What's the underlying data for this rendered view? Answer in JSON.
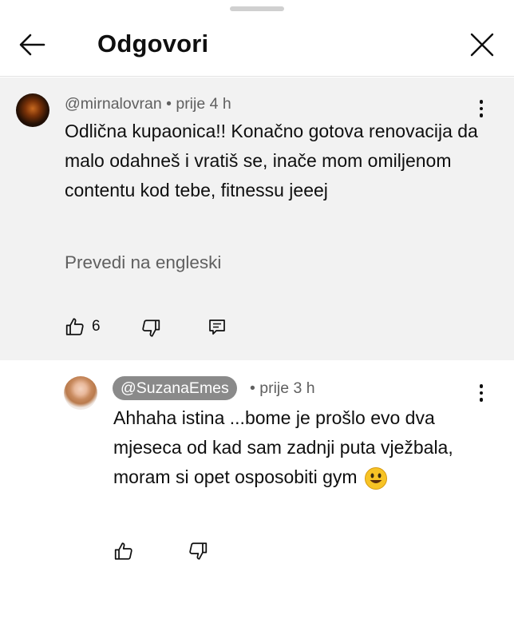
{
  "header": {
    "title": "Odgovori",
    "back_icon": "arrow-left-icon",
    "close_icon": "close-icon"
  },
  "parent_comment": {
    "handle": "@mirnalovran",
    "separator": "•",
    "time": "prije 4 h",
    "text": "Odlična kupaonica!! Konačno gotova renovacija da malo odahneš i vratiš se, inače mom omiljenom contentu kod tebe, fitnessu jeeej",
    "translate_label": "Prevedi na engleski",
    "like_count": "6",
    "icons": [
      "thumbs-up-icon",
      "thumbs-down-icon",
      "reply-icon",
      "more-vertical-icon"
    ]
  },
  "reply": {
    "handle": "@SuzanaEmes",
    "separator": "•",
    "time": "prije 3 h",
    "text": "Ahhaha istina ...bome je prošlo evo dva mjeseca od kad sam zadnji puta vježbala, moram si opet osposobiti gym",
    "emoji": "smiling-face-icon",
    "icons": [
      "thumbs-up-icon",
      "thumbs-down-icon",
      "more-vertical-icon"
    ]
  },
  "colors": {
    "parent_background": "#f2f2f2",
    "secondary_text": "#606060",
    "handle_chip": "#8a8a8a",
    "emoji_yellow": "#f7c325"
  }
}
